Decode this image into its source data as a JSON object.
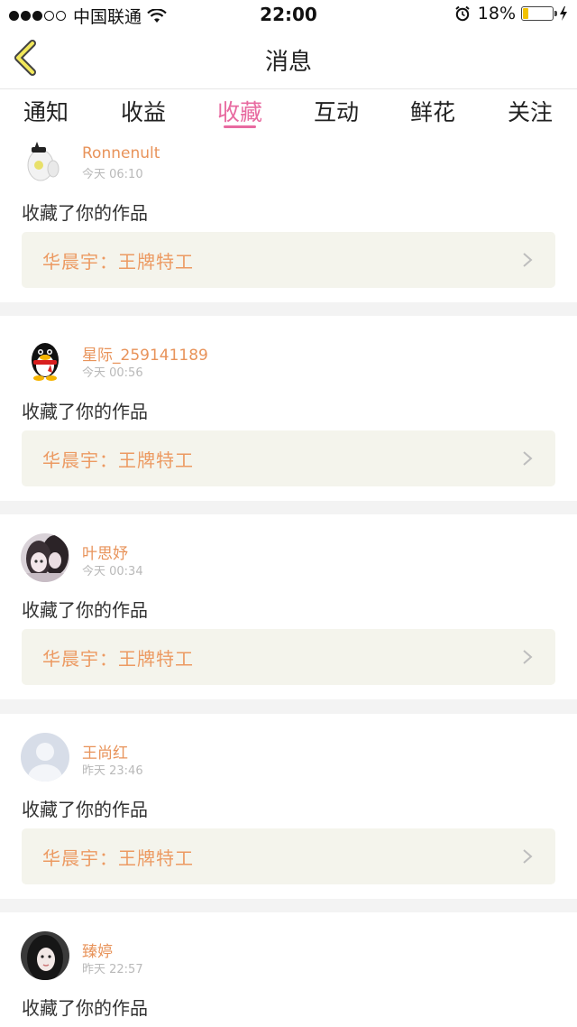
{
  "status_bar": {
    "carrier": "中国联通",
    "time": "22:00",
    "battery": "18%",
    "battery_level": 0.18
  },
  "nav": {
    "title": "消息",
    "back_icon": "chevron-left-icon"
  },
  "tabs": [
    {
      "label": "通知"
    },
    {
      "label": "收益"
    },
    {
      "label": "收藏",
      "active": true
    },
    {
      "label": "互动"
    },
    {
      "label": "鲜花"
    },
    {
      "label": "关注"
    }
  ],
  "messages": [
    {
      "user": "Ronnenult",
      "time": "今天 06:10",
      "action": "收藏了你的作品",
      "work": "华晨宇：王牌特工"
    },
    {
      "user": "星际_259141189",
      "time": "今天 00:56",
      "action": "收藏了你的作品",
      "work": "华晨宇：王牌特工"
    },
    {
      "user": "叶思妤",
      "time": "今天 00:34",
      "action": "收藏了你的作品",
      "work": "华晨宇：王牌特工"
    },
    {
      "user": "王尚红",
      "time": "昨天 23:46",
      "action": "收藏了你的作品",
      "work": "华晨宇：王牌特工"
    },
    {
      "user": "臻婷",
      "time": "昨天 22:57",
      "action": "收藏了你的作品"
    }
  ],
  "colors": {
    "accent": "#e86aa0",
    "username": "#e8935a",
    "work_title": "#ec9a62",
    "work_bg": "#f4f4ec"
  }
}
